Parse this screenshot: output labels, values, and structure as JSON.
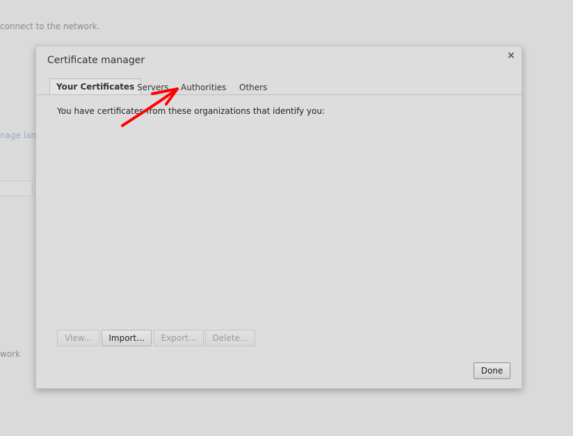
{
  "background": {
    "status_text": "connect to the network.",
    "link_text": "nage lang",
    "network_text": "work"
  },
  "dialog": {
    "title": "Certificate manager",
    "close_symbol": "×",
    "tabs": [
      {
        "label": "Your Certificates",
        "active": true
      },
      {
        "label": "Servers",
        "active": false
      },
      {
        "label": "Authorities",
        "active": false
      },
      {
        "label": "Others",
        "active": false
      }
    ],
    "description": "You have certificates from these organizations that identify you:",
    "buttons": {
      "view": "View...",
      "import": "Import...",
      "export": "Export...",
      "delete": "Delete..."
    },
    "done_label": "Done"
  },
  "colors": {
    "annotation_arrow": "#ff0000",
    "link": "#9aa9c4"
  }
}
